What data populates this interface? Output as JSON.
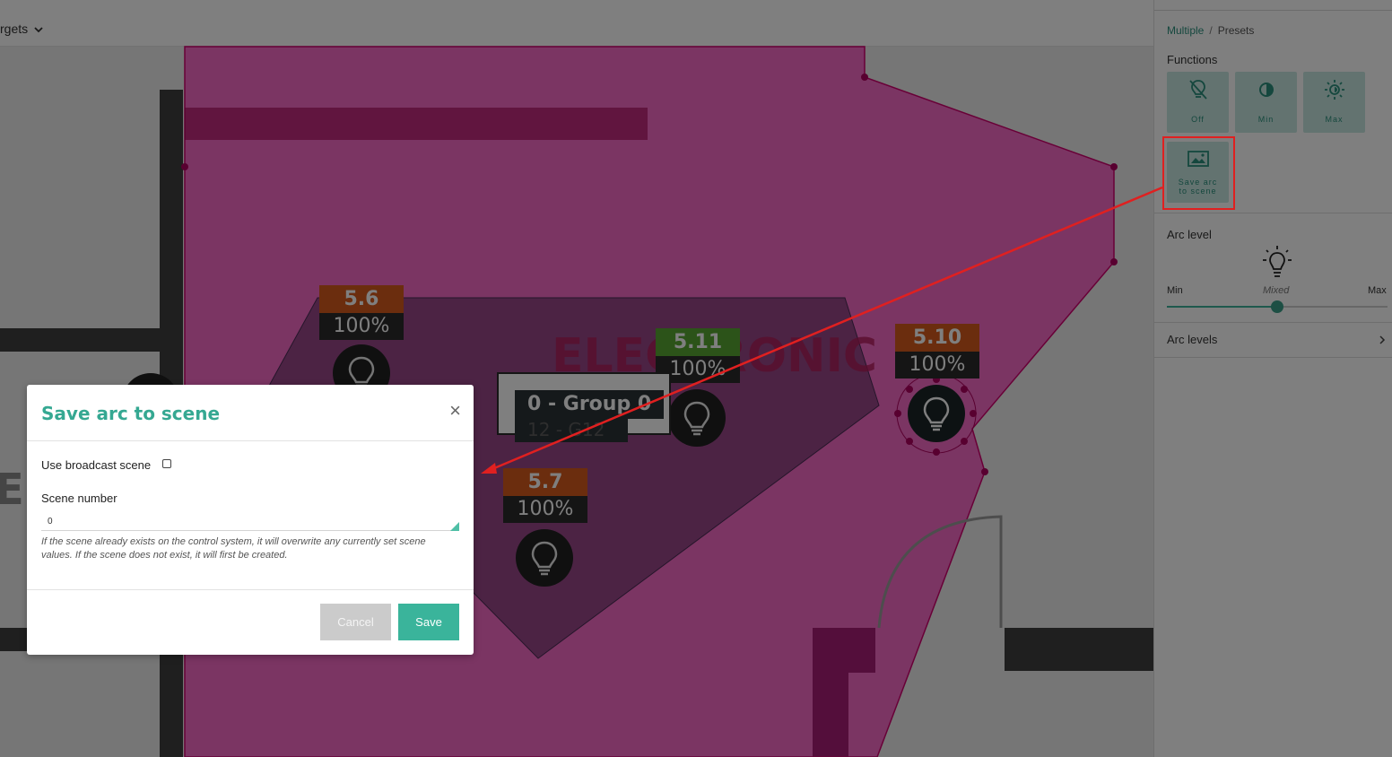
{
  "topbar": {
    "targets_label": "rgets"
  },
  "map": {
    "zone_label_electronic": "ELECTRONIC",
    "zone_label_left": "EF",
    "group": {
      "title": "0 - Group 0",
      "subtitle": "12 - G12"
    },
    "fixtures": [
      {
        "address": "5.6",
        "level": "100%",
        "status_color": "#d65a1c"
      },
      {
        "address": "5.11",
        "level": "100%",
        "status_color": "#59a632"
      },
      {
        "address": "5.10",
        "level": "100%",
        "status_color": "#d65a1c"
      },
      {
        "address": "5.7",
        "level": "100%",
        "status_color": "#d65a1c"
      }
    ],
    "colors": {
      "zone": "#ff00a6",
      "zone_border": "#d0006e",
      "group_zone": "#4a2a55"
    }
  },
  "panel": {
    "breadcrumb": {
      "first": "Multiple",
      "separator": "/",
      "second": "Presets"
    },
    "functions_title": "Functions",
    "functions": [
      {
        "label": "Off",
        "icon": "bulb-off-icon"
      },
      {
        "label": "Min",
        "icon": "half-circle-icon"
      },
      {
        "label": "Max",
        "icon": "sun-icon"
      },
      {
        "label": "Save arc to scene",
        "icon": "image-icon"
      }
    ],
    "arc_level_title": "Arc level",
    "arc_level_icon": "lightbulb-icon",
    "slider": {
      "min_label": "Min",
      "mid_label": "Mixed",
      "max_label": "Max",
      "value_fraction": 0.5
    },
    "arc_levels_title": "Arc levels",
    "accent": "#3ab49b"
  },
  "modal": {
    "title": "Save arc to scene",
    "close": "×",
    "broadcast_label": "Use broadcast scene",
    "scene_number_label": "Scene number",
    "scene_number_value": "0",
    "hint": "If the scene already exists on the control system, it will overwrite any currently set scene values. If the scene does not exist, it will first be created.",
    "cancel_label": "Cancel",
    "save_label": "Save"
  }
}
